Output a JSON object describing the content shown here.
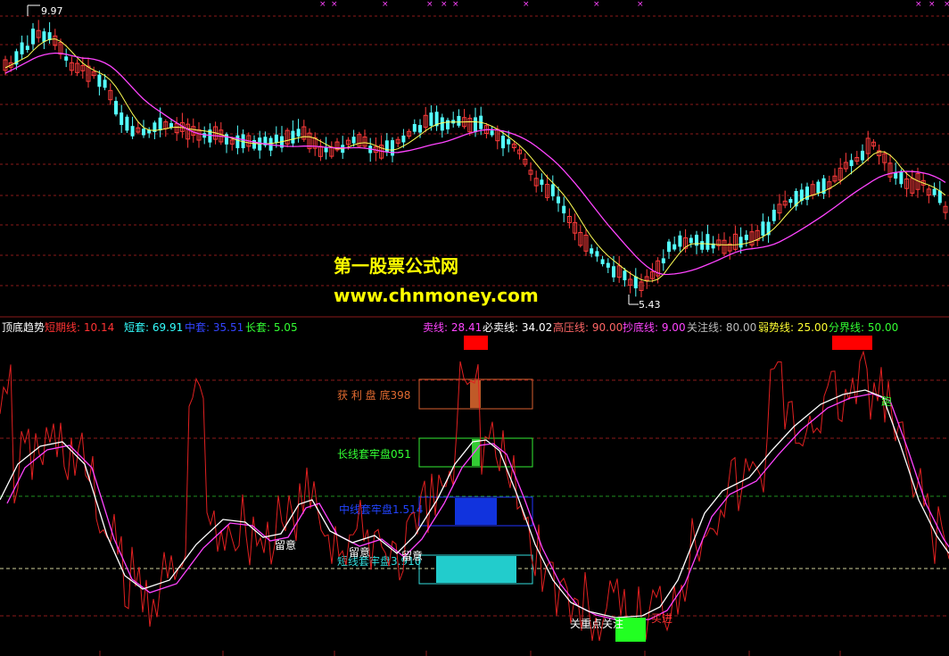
{
  "colors": {
    "background": "#000000",
    "grid": "#8b1a1a",
    "up_candle": "#ff3b3b",
    "down_candle": "#54ffff",
    "ma_short": "#ffff55",
    "ma_long": "#ff44ff",
    "osc_white": "#ffffff",
    "osc_magenta": "#ff44ff",
    "osc_red": "#e02020"
  },
  "price_panel": {
    "high_label": "9.97",
    "low_label": "5.43"
  },
  "watermark": {
    "line1": "第一股票公式网",
    "line2": "www.chnmoney.com"
  },
  "indicator_bar": {
    "name": "顶底趋势",
    "items": [
      {
        "text": "短期线: 10.14",
        "color": "#ff3333"
      },
      {
        "text": "短套: 69.91",
        "color": "#33ffff"
      },
      {
        "text": "中套: 35.51",
        "color": "#3344ff"
      },
      {
        "text": "长套: 5.05",
        "color": "#33ff33"
      },
      {
        "text": "卖线: 28.41",
        "color": "#ff44ff"
      },
      {
        "text": "必卖线: 34.02",
        "color": "#ffffff"
      },
      {
        "text": "高压线: 90.00",
        "color": "#ff6666"
      },
      {
        "text": "抄底线: 9.00",
        "color": "#ff44ff"
      },
      {
        "text": "关注线: 80.00",
        "color": "#bbbbbb"
      },
      {
        "text": "弱势线: 25.00",
        "color": "#ffff33"
      },
      {
        "text": "分界线: 50.00",
        "color": "#33ff33"
      }
    ]
  },
  "zone_labels": {
    "profit": "获 利 盘 底398",
    "long_trap": "长线套牢盘051",
    "mid_trap": "中线套牢盘1.514",
    "short_trap": "短线套牢盘3.910"
  },
  "annotations": {
    "watch_note": "留意",
    "focus_point": "关重点关注",
    "buy_signal": "买进",
    "run_signal": "跑"
  }
}
